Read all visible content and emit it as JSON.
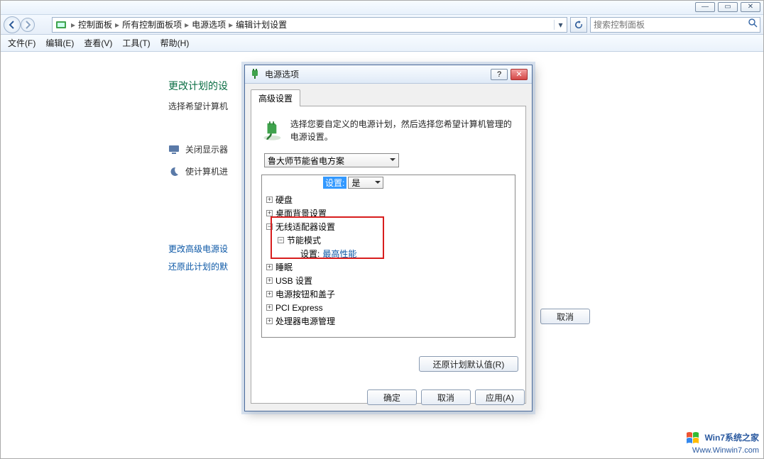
{
  "window_controls": {
    "min": "—",
    "max": "▭",
    "close": "✕"
  },
  "breadcrumb": {
    "items": [
      "控制面板",
      "所有控制面板项",
      "电源选项",
      "编辑计划设置"
    ]
  },
  "search": {
    "placeholder": "搜索控制面板"
  },
  "menu": {
    "file": "文件(F)",
    "edit": "编辑(E)",
    "view": "查看(V)",
    "tools": "工具(T)",
    "help": "帮助(H)"
  },
  "page": {
    "title": "更改计划的设",
    "subtitle": "选择希望计算机",
    "line1": "关闭显示器",
    "line2": "使计算机进",
    "link1": "更改高级电源设",
    "link2": "还原此计划的默",
    "cancel": "取消"
  },
  "dialog": {
    "title": "电源选项",
    "help": "?",
    "close": "✕",
    "tab": "高级设置",
    "intro": "选择您要自定义的电源计划，然后选择您希望计算机管理的电源设置。",
    "plan": "鲁大师节能省电方案",
    "setting_label": "设置:",
    "setting_value": "是",
    "tree": {
      "n_harddisk": "硬盘",
      "n_desktop": "桌面背景设置",
      "n_wireless": "无线适配器设置",
      "n_powersave": "节能模式",
      "n_setting_label": "设置:",
      "n_setting_value": "最高性能",
      "n_sleep": "睡眠",
      "n_usb": "USB 设置",
      "n_powerbtn": "电源按钮和盖子",
      "n_pci": "PCI Express",
      "n_cpu": "处理器电源管理"
    },
    "restore": "还原计划默认值(R)",
    "ok": "确定",
    "cancel": "取消",
    "apply": "应用(A)"
  },
  "watermark": {
    "brand": "Win7系统之家",
    "url": "Www.Winwin7.com"
  }
}
